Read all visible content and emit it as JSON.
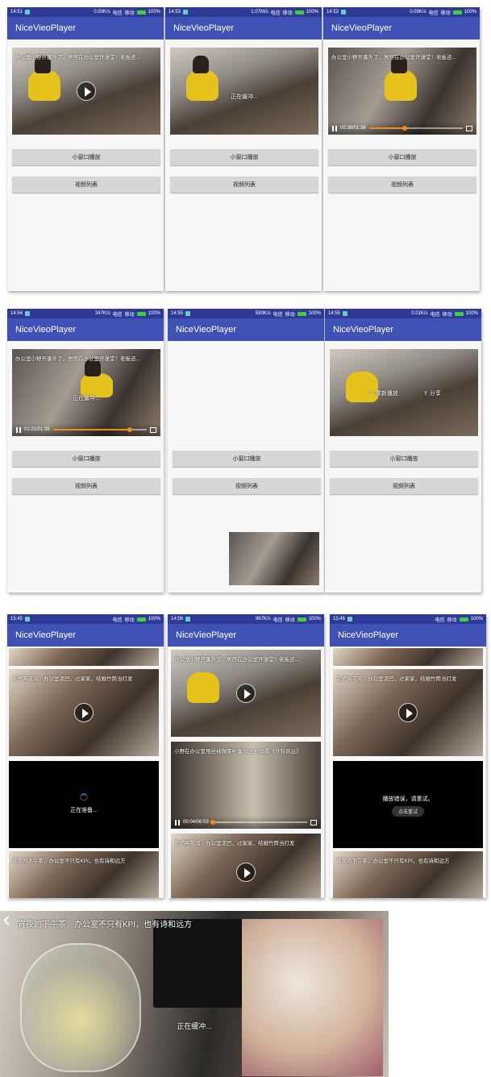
{
  "app_title": "NiceVieoPlayer",
  "statusbars": [
    {
      "time": "14:51",
      "net": "0.00K/s",
      "carrier": "电信",
      "carrier2": "移动",
      "battery": "100%"
    },
    {
      "time": "14:53",
      "net": "1.07M/s",
      "carrier": "电信",
      "carrier2": "移动",
      "battery": "100%"
    },
    {
      "time": "14:53",
      "net": "0.00K/s",
      "carrier": "电信",
      "carrier2": "移动",
      "battery": "100%"
    },
    {
      "time": "14:54",
      "net": "347K/s",
      "carrier": "电信",
      "carrier2": "移动",
      "battery": "100%"
    },
    {
      "time": "14:55",
      "net": "590K/s",
      "carrier": "电信",
      "carrier2": "移动",
      "battery": "100%"
    },
    {
      "time": "14:55",
      "net": "0.01K/s",
      "carrier": "电信",
      "carrier2": "移动",
      "battery": "100%"
    },
    {
      "time": "15:45",
      "net": "",
      "carrier": "电信",
      "carrier2": "移动",
      "battery": "100%"
    },
    {
      "time": "14:56",
      "net": "967K/s",
      "carrier": "电信",
      "carrier2": "移动",
      "battery": "100%"
    },
    {
      "time": "15:46",
      "net": "",
      "carrier": "电信",
      "carrier2": "移动",
      "battery": "100%"
    }
  ],
  "video_title_1": "办公室小野开番外了，居然在办公室开澡堂！老板还...",
  "video_title_2": "小野在办公室用丝袜做茶叶蛋 边上班边看《外科风云》",
  "video_title_3": "花式叫花鸡，办公室泥巴，过家家，结婚竹筒当打发",
  "video_title_4": "宵夜的下午茶，办公室不只有KPI，也有诗和远方",
  "buttons": {
    "small_window": "小窗口播放",
    "video_list": "视频列表"
  },
  "states": {
    "buffering": "正在缓冲...",
    "preparing": "正在准备...",
    "error": "播放错误，请重试。",
    "retry": "点击重试",
    "replay": "重新播放",
    "share": "分享"
  },
  "times": {
    "p3": "00:38/01:38",
    "p4": "01:21/01:38",
    "p8": "00:04/06:53"
  },
  "progress": {
    "p3": 0.38,
    "p4": 0.82,
    "p8": 0.01
  },
  "big_title": "宵夜的下午茶，办公室不只有KPI，也有诗和远方",
  "big_buffering": "正在缓冲..."
}
